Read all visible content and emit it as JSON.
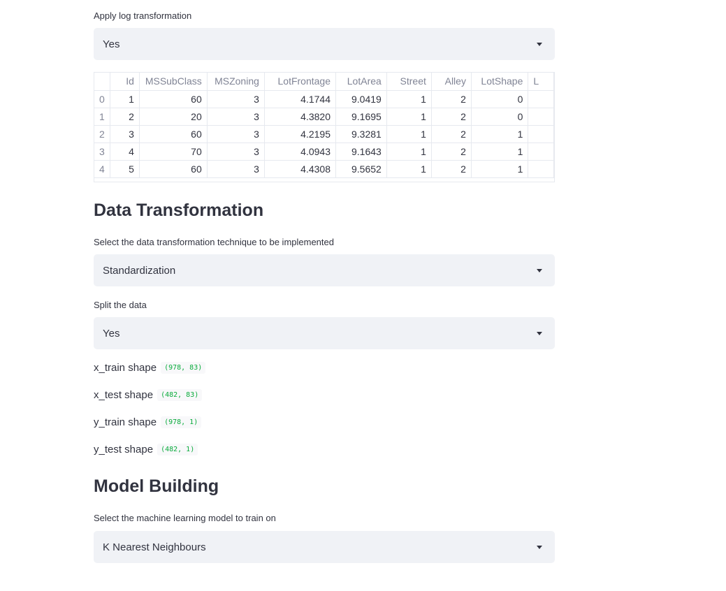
{
  "log_section": {
    "label": "Apply log transformation",
    "selected": "Yes"
  },
  "dataframe": {
    "columns": [
      "",
      "Id",
      "MSSubClass",
      "MSZoning",
      "LotFrontage",
      "LotArea",
      "Street",
      "Alley",
      "LotShape",
      "L"
    ],
    "rows": [
      [
        "0",
        "1",
        "60",
        "3",
        "4.1744",
        "9.0419",
        "1",
        "2",
        "0",
        ""
      ],
      [
        "1",
        "2",
        "20",
        "3",
        "4.3820",
        "9.1695",
        "1",
        "2",
        "0",
        ""
      ],
      [
        "2",
        "3",
        "60",
        "3",
        "4.2195",
        "9.3281",
        "1",
        "2",
        "1",
        ""
      ],
      [
        "3",
        "4",
        "70",
        "3",
        "4.0943",
        "9.1643",
        "1",
        "2",
        "1",
        ""
      ],
      [
        "4",
        "5",
        "60",
        "3",
        "4.4308",
        "9.5652",
        "1",
        "2",
        "1",
        ""
      ]
    ]
  },
  "data_transformation": {
    "heading": "Data Transformation",
    "technique_label": "Select the data transformation technique to be implemented",
    "technique_selected": "Standardization",
    "split_label": "Split the data",
    "split_selected": "Yes"
  },
  "shapes": [
    {
      "label": "x_train shape",
      "value": "(978, 83)"
    },
    {
      "label": "x_test shape",
      "value": "(482, 83)"
    },
    {
      "label": "y_train shape",
      "value": "(978, 1)"
    },
    {
      "label": "y_test shape",
      "value": "(482, 1)"
    }
  ],
  "model_building": {
    "heading": "Model Building",
    "model_label": "Select the machine learning model to train on",
    "model_selected": "K Nearest Neighbours"
  },
  "colors": {
    "select_bg": "#f0f2f6",
    "text": "#31333f",
    "muted": "#808495",
    "code_green": "#09ab3b"
  }
}
